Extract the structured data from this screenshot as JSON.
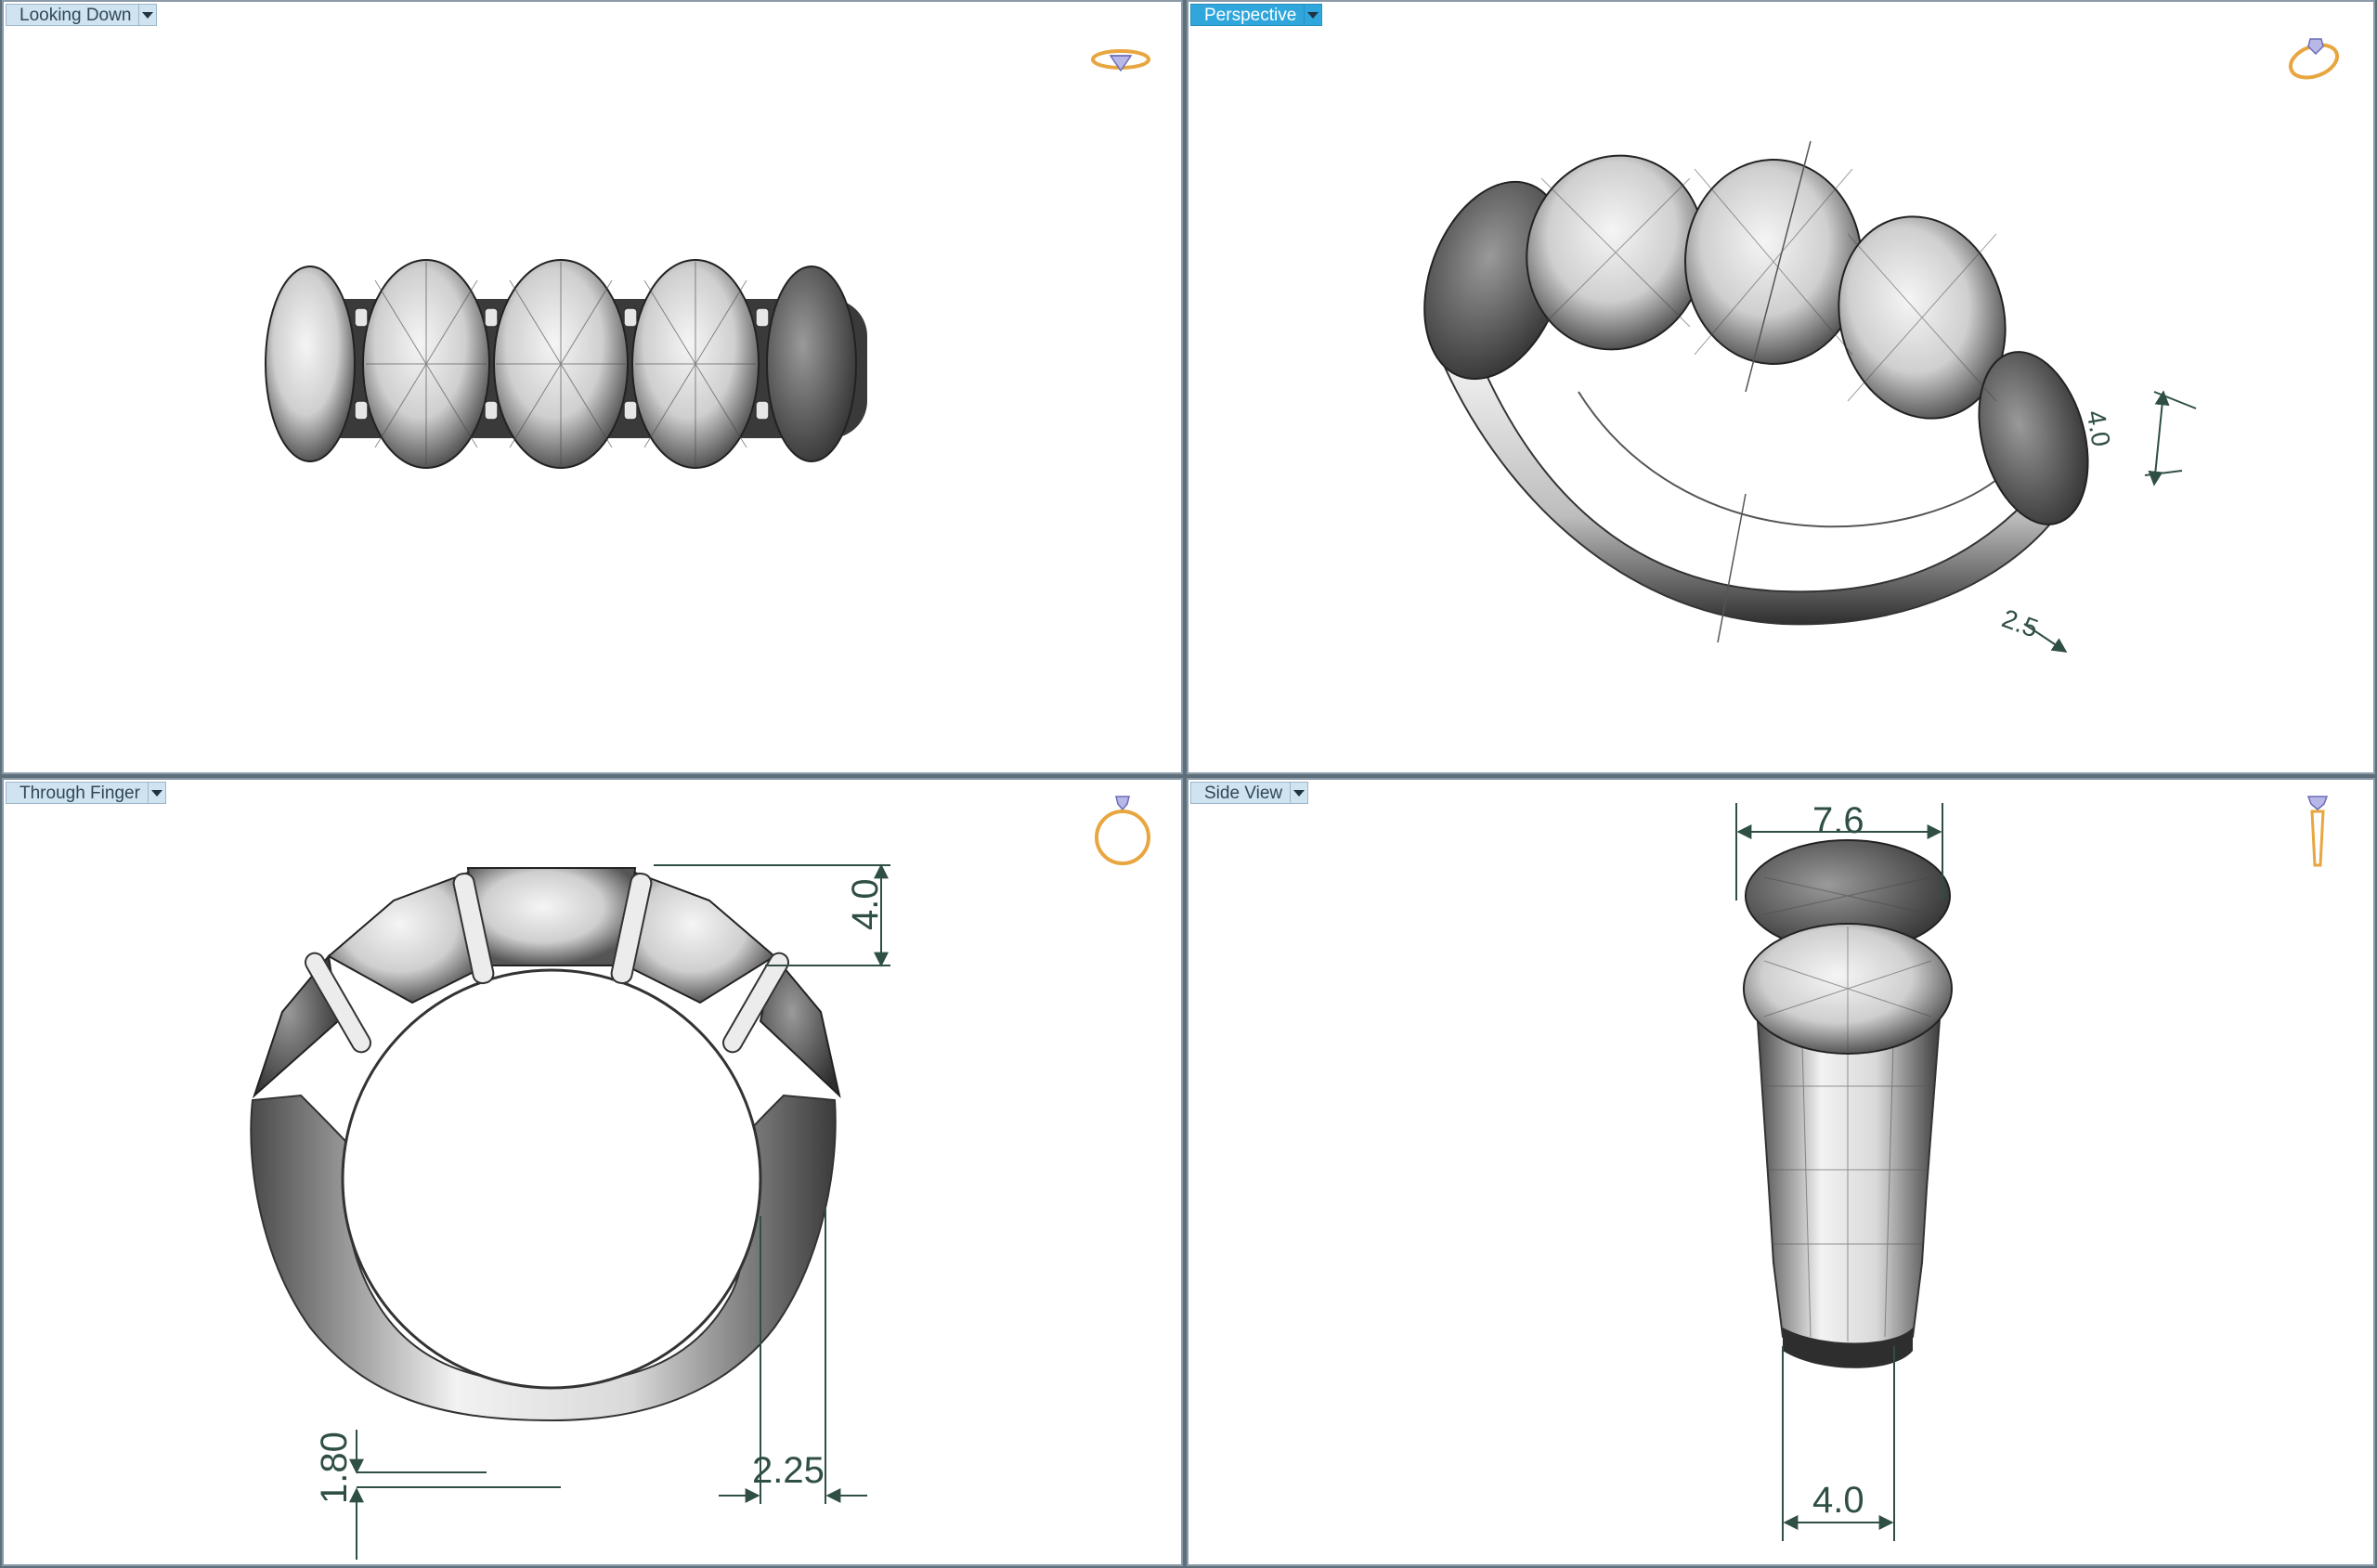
{
  "viewports": {
    "top_left": {
      "label": "Looking Down"
    },
    "top_right": {
      "label": "Perspective"
    },
    "bottom_left": {
      "label": "Through Finger"
    },
    "bottom_right": {
      "label": "Side View"
    }
  },
  "dimensions": {
    "front_height": "4.0",
    "bottom_thickness": "1.80",
    "shank_width": "2.25",
    "top_width": "7.6",
    "bottom_width": "4.0",
    "perspective_height": "4.0",
    "perspective_width": "2.5"
  },
  "icons": {
    "looking_down": "ring-top-view-icon",
    "perspective": "ring-perspective-icon",
    "through_finger": "ring-front-view-icon",
    "side_view": "ring-side-view-icon",
    "pin": "pin-icon"
  },
  "colors": {
    "active_tab": "#2fa6dc",
    "inactive_tab": "#cfe3f1",
    "dimension": "#2f4f45",
    "gold_icon": "#e8a640",
    "frame": "#5e6f7c"
  }
}
